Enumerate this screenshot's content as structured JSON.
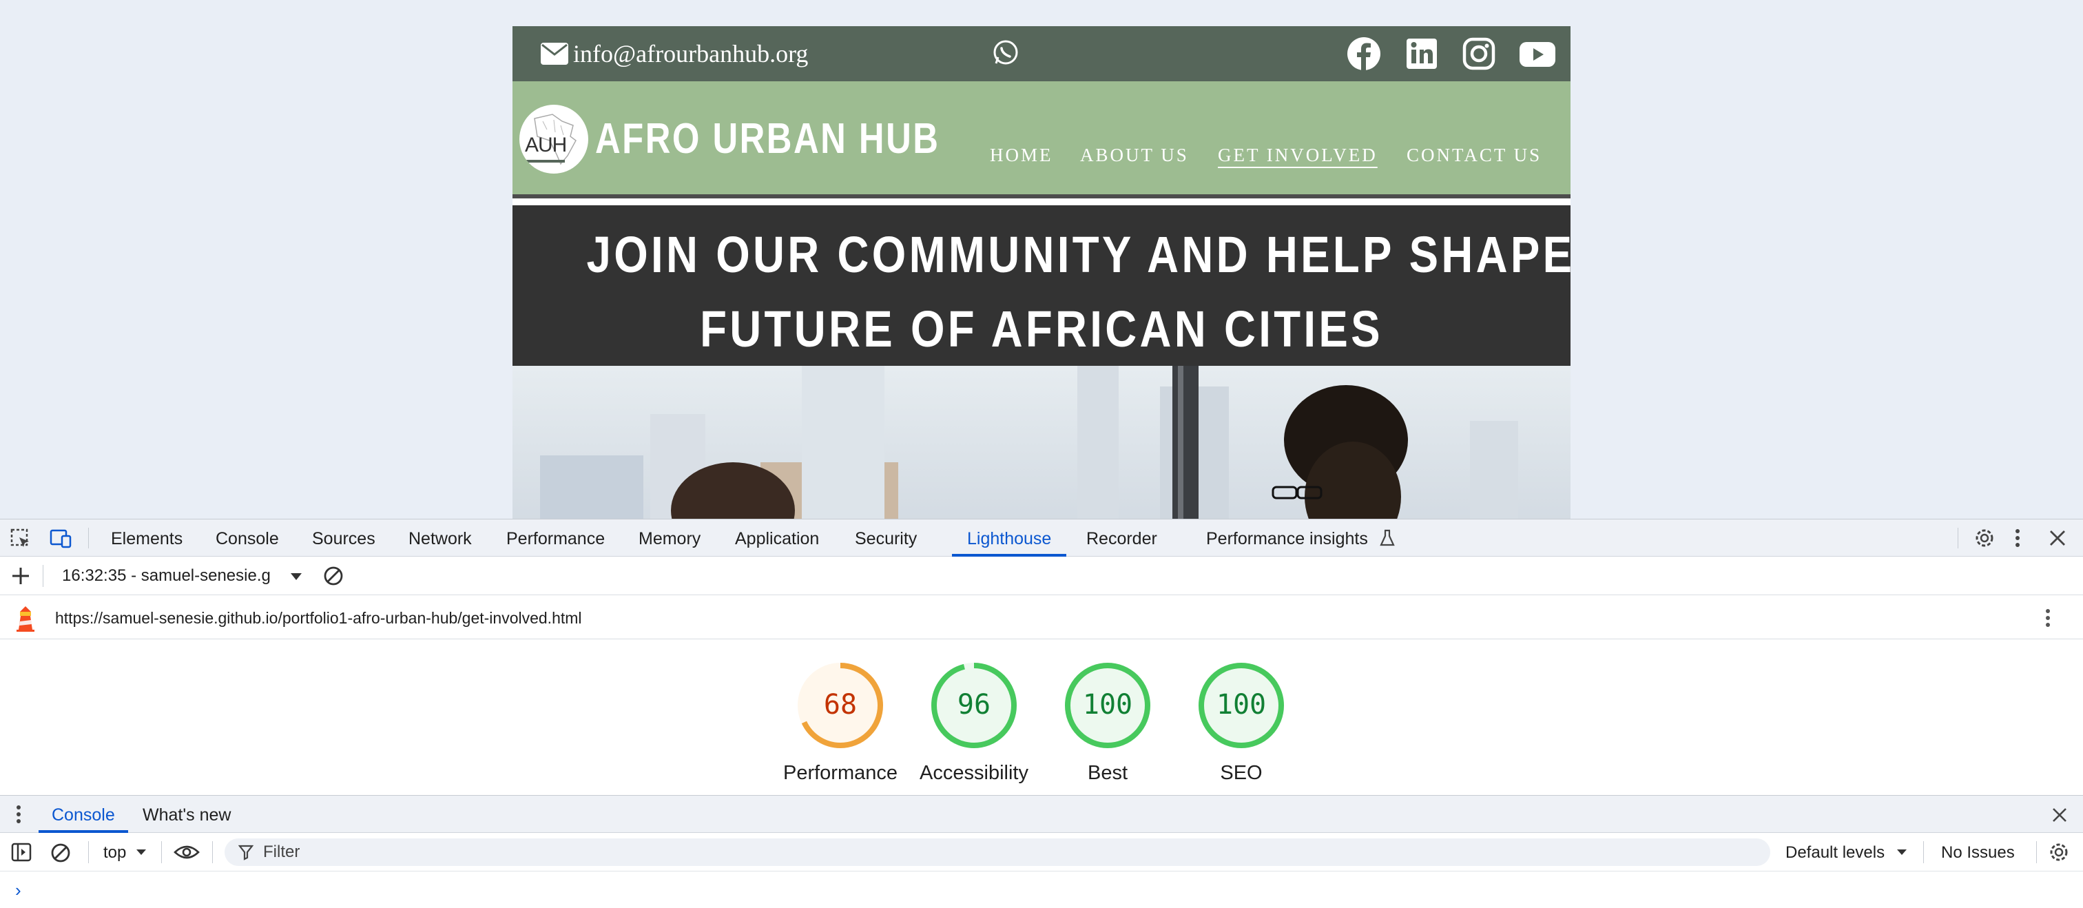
{
  "website": {
    "email": "info@afrourbanhub.org",
    "logo_text": "AUH",
    "brand": "AFRO URBAN HUB",
    "nav": [
      {
        "label": "HOME"
      },
      {
        "label": "ABOUT US"
      },
      {
        "label": "GET INVOLVED"
      },
      {
        "label": "CONTACT US"
      }
    ],
    "active_nav": "GET INVOLVED",
    "hero_title": "JOIN OUR COMMUNITY AND HELP SHAPE THE FUTURE OF AFRICAN CITIES",
    "hero_line1": "JOIN OUR COMMUNITY AND HELP SHAPE THE",
    "hero_line2": "FUTURE OF AFRICAN CITIES",
    "social_icons": [
      "facebook-icon",
      "linkedin-icon",
      "instagram-icon",
      "youtube-icon"
    ],
    "colors": {
      "topbar": "#56665a",
      "navbar": "#9dbc91",
      "hero": "#333333"
    }
  },
  "devtools": {
    "tabs": [
      {
        "label": "Elements"
      },
      {
        "label": "Console"
      },
      {
        "label": "Sources"
      },
      {
        "label": "Network"
      },
      {
        "label": "Performance"
      },
      {
        "label": "Memory"
      },
      {
        "label": "Application"
      },
      {
        "label": "Security"
      },
      {
        "label": "Lighthouse"
      },
      {
        "label": "Recorder"
      },
      {
        "label": "Performance insights"
      }
    ],
    "active_tab": "Lighthouse",
    "lighthouse": {
      "report_select": "16:32:35 - samuel-senesie.g",
      "url": "https://samuel-senesie.github.io/portfolio1-afro-urban-hub/get-involved.html",
      "scores": [
        {
          "label": "Performance",
          "value": 68,
          "value_text": "68",
          "color": "#f0a33a",
          "text_color": "#c33300",
          "fill": "#fff7ec"
        },
        {
          "label": "Accessibility",
          "value": 96,
          "value_text": "96",
          "color": "#47c95d",
          "text_color": "#118034",
          "fill": "#edf9ef"
        },
        {
          "label": "Best",
          "value": 100,
          "value_text": "100",
          "color": "#47c95d",
          "text_color": "#118034",
          "fill": "#edf9ef"
        },
        {
          "label": "SEO",
          "value": 100,
          "value_text": "100",
          "color": "#47c95d",
          "text_color": "#118034",
          "fill": "#edf9ef"
        }
      ]
    },
    "drawer": {
      "tabs": [
        {
          "label": "Console"
        },
        {
          "label": "What's new"
        }
      ],
      "active_tab": "Console",
      "context": "top",
      "filter_placeholder": "Filter",
      "levels": "Default levels",
      "issues": "No Issues",
      "prompt": "›"
    },
    "accent": "#0b57d0"
  }
}
